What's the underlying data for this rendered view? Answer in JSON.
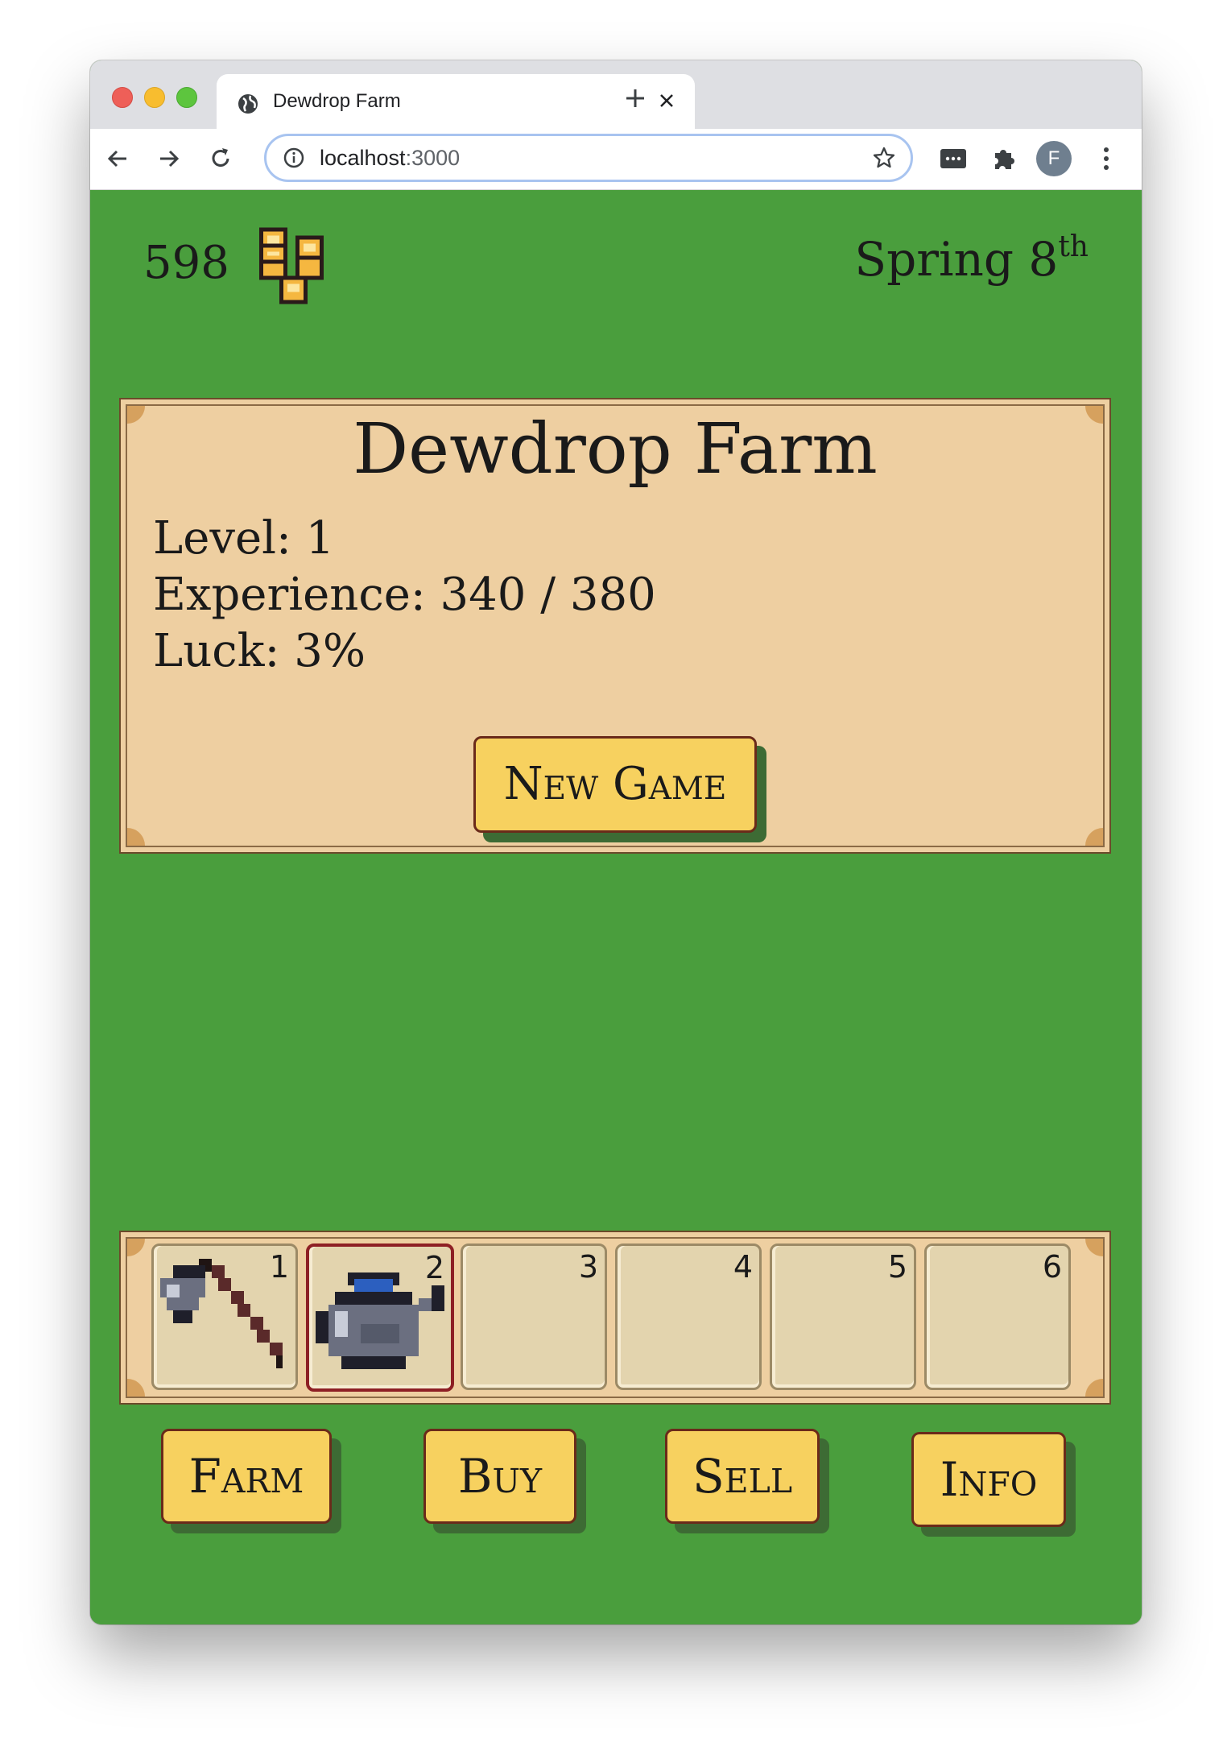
{
  "browser": {
    "tab_title": "Dewdrop Farm",
    "url_host": "localhost",
    "url_port": ":3000",
    "avatar_letter": "F"
  },
  "header": {
    "gold": "598",
    "date_season": "Spring 8",
    "date_suffix": "th"
  },
  "info_panel": {
    "title": "Dewdrop Farm",
    "level": "Level: 1",
    "experience": "Experience: 340 / 380",
    "luck": "Luck: 3%",
    "new_game_label": "New Game"
  },
  "hotbar": {
    "slots": [
      {
        "number": "1",
        "item": "hoe-icon"
      },
      {
        "number": "2",
        "item": "watering-can-icon",
        "selected": true
      },
      {
        "number": "3",
        "item": ""
      },
      {
        "number": "4",
        "item": ""
      },
      {
        "number": "5",
        "item": ""
      },
      {
        "number": "6",
        "item": ""
      }
    ]
  },
  "nav": {
    "farm": "Farm",
    "buy": "Buy",
    "sell": "Sell",
    "info": "Info"
  },
  "colors": {
    "background": "#4a9e3d",
    "panel": "#eecfa1",
    "button": "#f7d15f",
    "selected_slot": "#8e1f24"
  }
}
